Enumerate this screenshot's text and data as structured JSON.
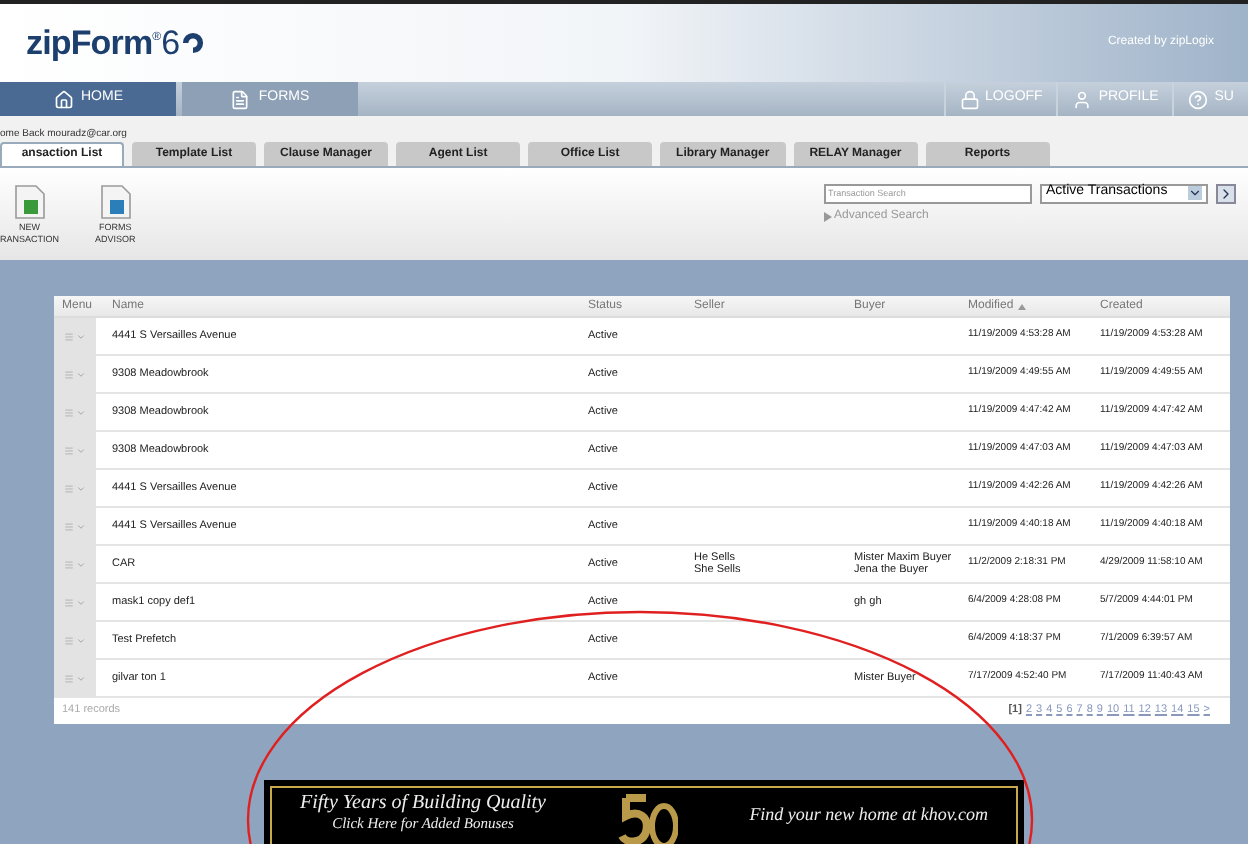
{
  "header": {
    "logo": "zipForm",
    "logo_mark": "®",
    "logo_version": "6",
    "credit": "Created by zipLogix"
  },
  "nav": {
    "left": [
      {
        "label": "HOME",
        "kind": "home",
        "selected": true
      },
      {
        "label": "FORMS",
        "kind": "forms",
        "selected": false
      }
    ],
    "right": [
      {
        "label": "LOGOFF",
        "kind": "lock"
      },
      {
        "label": "PROFILE",
        "kind": "person"
      },
      {
        "label": "SU",
        "kind": "help"
      }
    ]
  },
  "welcome": "ome Back mouradz@car.org",
  "tabs": [
    {
      "label": "ansaction List",
      "selected": true
    },
    {
      "label": "Template List",
      "selected": false
    },
    {
      "label": "Clause Manager",
      "selected": false
    },
    {
      "label": "Agent List",
      "selected": false
    },
    {
      "label": "Office List",
      "selected": false
    },
    {
      "label": "Library Manager",
      "selected": false
    },
    {
      "label": "RELAY Manager",
      "selected": false
    },
    {
      "label": "Reports",
      "selected": false
    }
  ],
  "toolbar": [
    {
      "line1": "NEW",
      "line2": "RANSACTION",
      "kind": "new"
    },
    {
      "line1": "FORMS",
      "line2": "ADVISOR",
      "kind": "advisor"
    }
  ],
  "search": {
    "placeholder": "Transaction Search",
    "filter": "Active Transactions",
    "advanced": "Advanced Search"
  },
  "table": {
    "columns": [
      "Menu",
      "Name",
      "Status",
      "Seller",
      "Buyer",
      "Modified",
      "Created"
    ],
    "rows": [
      {
        "name": "4441 S Versailles Avenue",
        "status": "Active",
        "seller": [],
        "buyer": [],
        "modified": "11/19/2009 4:53:28 AM",
        "created": "11/19/2009 4:53:28 AM"
      },
      {
        "name": "9308 Meadowbrook",
        "status": "Active",
        "seller": [],
        "buyer": [],
        "modified": "11/19/2009 4:49:55 AM",
        "created": "11/19/2009 4:49:55 AM"
      },
      {
        "name": "9308 Meadowbrook",
        "status": "Active",
        "seller": [],
        "buyer": [],
        "modified": "11/19/2009 4:47:42 AM",
        "created": "11/19/2009 4:47:42 AM"
      },
      {
        "name": "9308 Meadowbrook",
        "status": "Active",
        "seller": [],
        "buyer": [],
        "modified": "11/19/2009 4:47:03 AM",
        "created": "11/19/2009 4:47:03 AM"
      },
      {
        "name": "4441 S Versailles Avenue",
        "status": "Active",
        "seller": [],
        "buyer": [],
        "modified": "11/19/2009 4:42:26 AM",
        "created": "11/19/2009 4:42:26 AM"
      },
      {
        "name": "4441 S Versailles Avenue",
        "status": "Active",
        "seller": [],
        "buyer": [],
        "modified": "11/19/2009 4:40:18 AM",
        "created": "11/19/2009 4:40:18 AM"
      },
      {
        "name": "CAR",
        "status": "Active",
        "seller": [
          "He Sells",
          "She Sells"
        ],
        "buyer": [
          "Mister Maxim Buyer",
          "Jena the Buyer"
        ],
        "modified": "11/2/2009 2:18:31 PM",
        "created": "4/29/2009 11:58:10 AM"
      },
      {
        "name": "mask1 copy def1",
        "status": "Active",
        "seller": [],
        "buyer": [
          "gh gh"
        ],
        "modified": "6/4/2009 4:28:08 PM",
        "created": "5/7/2009 4:44:01 PM"
      },
      {
        "name": "Test Prefetch",
        "status": "Active",
        "seller": [],
        "buyer": [],
        "modified": "6/4/2009 4:18:37 PM",
        "created": "7/1/2009 6:39:57 AM"
      },
      {
        "name": "gilvar ton 1",
        "status": "Active",
        "seller": [],
        "buyer": [
          "Mister Buyer"
        ],
        "modified": "7/17/2009 4:52:40 PM",
        "created": "7/17/2009 11:40:43 AM"
      }
    ],
    "records": "141 records",
    "pages": [
      {
        "label": "[1]",
        "selected": true
      },
      {
        "label": "2",
        "selected": false
      },
      {
        "label": "3",
        "selected": false
      },
      {
        "label": "4",
        "selected": false
      },
      {
        "label": "5",
        "selected": false
      },
      {
        "label": "6",
        "selected": false
      },
      {
        "label": "7",
        "selected": false
      },
      {
        "label": "8",
        "selected": false
      },
      {
        "label": "9",
        "selected": false
      },
      {
        "label": "10",
        "selected": false
      },
      {
        "label": "11",
        "selected": false
      },
      {
        "label": "12",
        "selected": false
      },
      {
        "label": "13",
        "selected": false
      },
      {
        "label": "14",
        "selected": false
      },
      {
        "label": "15",
        "selected": false
      },
      {
        "label": ">",
        "selected": false
      }
    ]
  },
  "banner": {
    "headline": "Fifty Years of Building Quality",
    "subline": "Click Here for Added Bonuses",
    "tagline": "Find your new home at khov.com"
  }
}
